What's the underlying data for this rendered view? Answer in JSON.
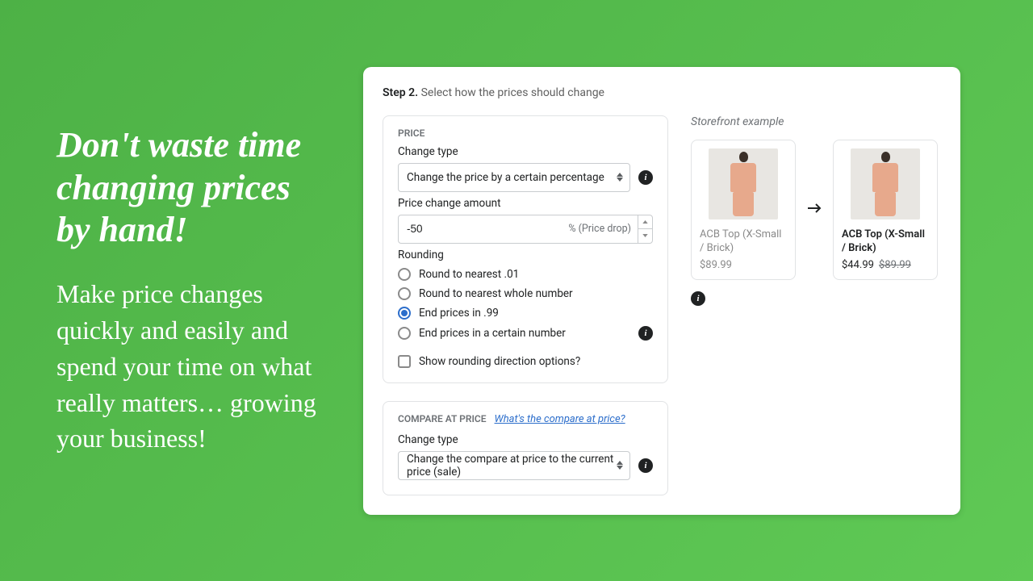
{
  "promo": {
    "headline": "Don't waste time changing prices by hand!",
    "subtext": "Make price changes quickly and easily and spend your time on what really matters… growing your business!"
  },
  "step": {
    "number": "Step 2.",
    "desc": "Select how the prices should change"
  },
  "price_panel": {
    "title": "PRICE",
    "change_type_label": "Change type",
    "change_type_value": "Change the price by a certain percentage",
    "amount_label": "Price change amount",
    "amount_value": "-50",
    "amount_unit": "% (Price drop)",
    "rounding_label": "Rounding",
    "rounding_options": [
      "Round to nearest .01",
      "Round to nearest whole number",
      "End prices in .99",
      "End prices in a certain number"
    ],
    "rounding_selected_index": 2,
    "show_rounding_direction": "Show rounding direction options?"
  },
  "compare_panel": {
    "title": "COMPARE AT PRICE",
    "link_text": "What's the compare at price?",
    "change_type_label": "Change type",
    "change_type_value": "Change the compare at price to the current price (sale)"
  },
  "storefront": {
    "label": "Storefront example",
    "product_name": "ACB Top (X-Small / Brick)",
    "before_price": "$89.99",
    "after_price": "$44.99",
    "after_compare": "$89.99"
  }
}
